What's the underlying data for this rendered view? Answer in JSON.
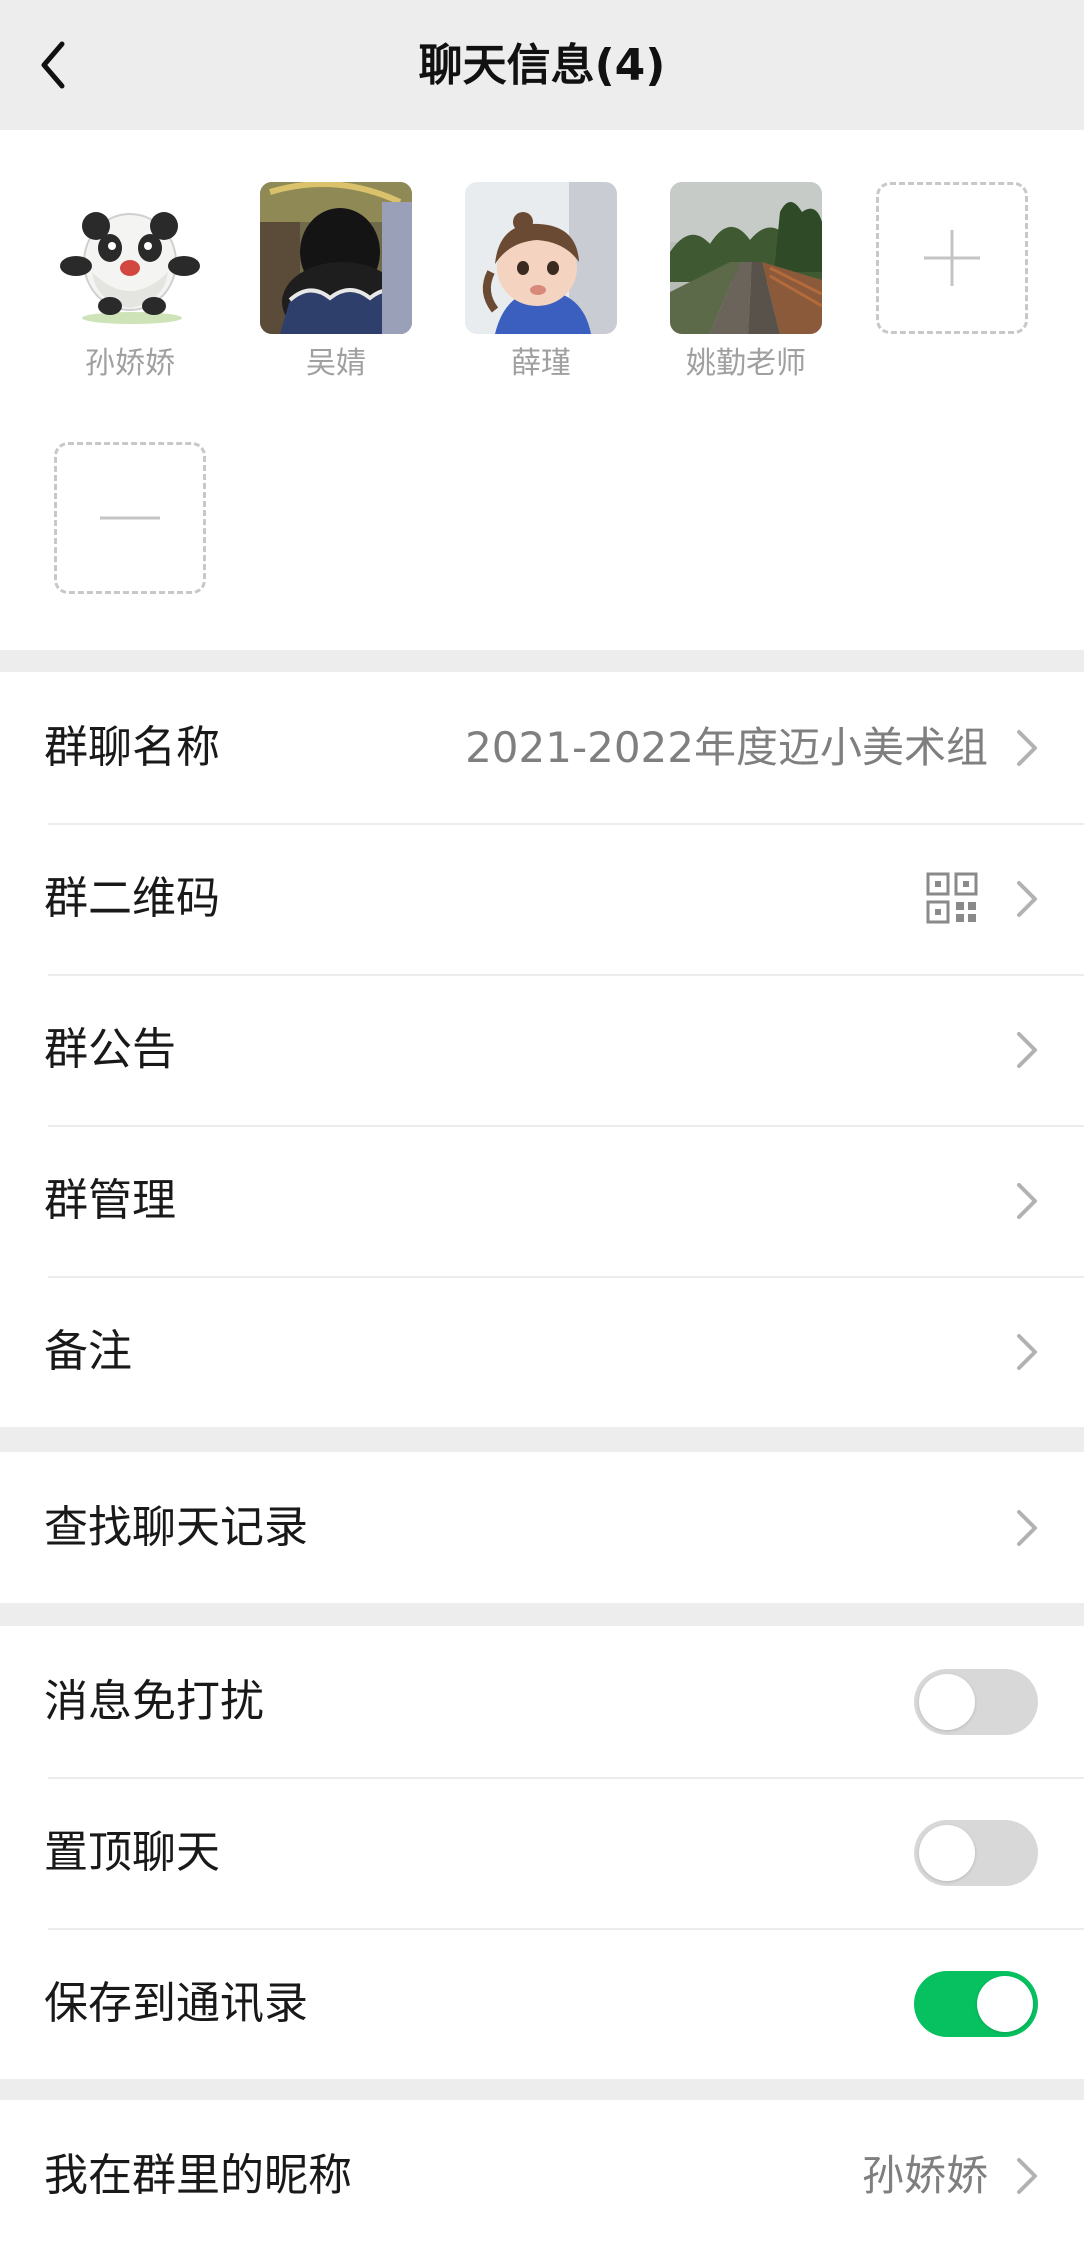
{
  "navbar": {
    "title": "聊天信息(4)",
    "back_icon": "chevron-left-icon"
  },
  "members": [
    {
      "name": "孙娇娇",
      "avatar": "panda-avatar"
    },
    {
      "name": "吴婧",
      "avatar": "photo-avatar"
    },
    {
      "name": "薛瑾",
      "avatar": "child-photo-avatar"
    },
    {
      "name": "姚勤老师",
      "avatar": "railway-photo-avatar"
    }
  ],
  "member_actions": {
    "add_icon": "plus-icon",
    "remove_icon": "minus-icon"
  },
  "group_info": {
    "name_label": "群聊名称",
    "name_value": "2021-2022年度迈小美术组",
    "qrcode_label": "群二维码",
    "qrcode_icon": "qr-code-icon",
    "notice_label": "群公告",
    "manage_label": "群管理",
    "remark_label": "备注"
  },
  "search": {
    "history_label": "查找聊天记录"
  },
  "settings": {
    "mute_label": "消息免打扰",
    "mute_on": false,
    "pin_label": "置顶聊天",
    "pin_on": false,
    "save_label": "保存到通讯录",
    "save_on": true
  },
  "nickname": {
    "label": "我在群里的昵称",
    "value": "孙娇娇"
  },
  "colors": {
    "background": "#ededed",
    "card": "#ffffff",
    "toggle_on": "#07c160",
    "toggle_off": "#d8d8d8",
    "secondary_text": "#7f7f7f"
  }
}
